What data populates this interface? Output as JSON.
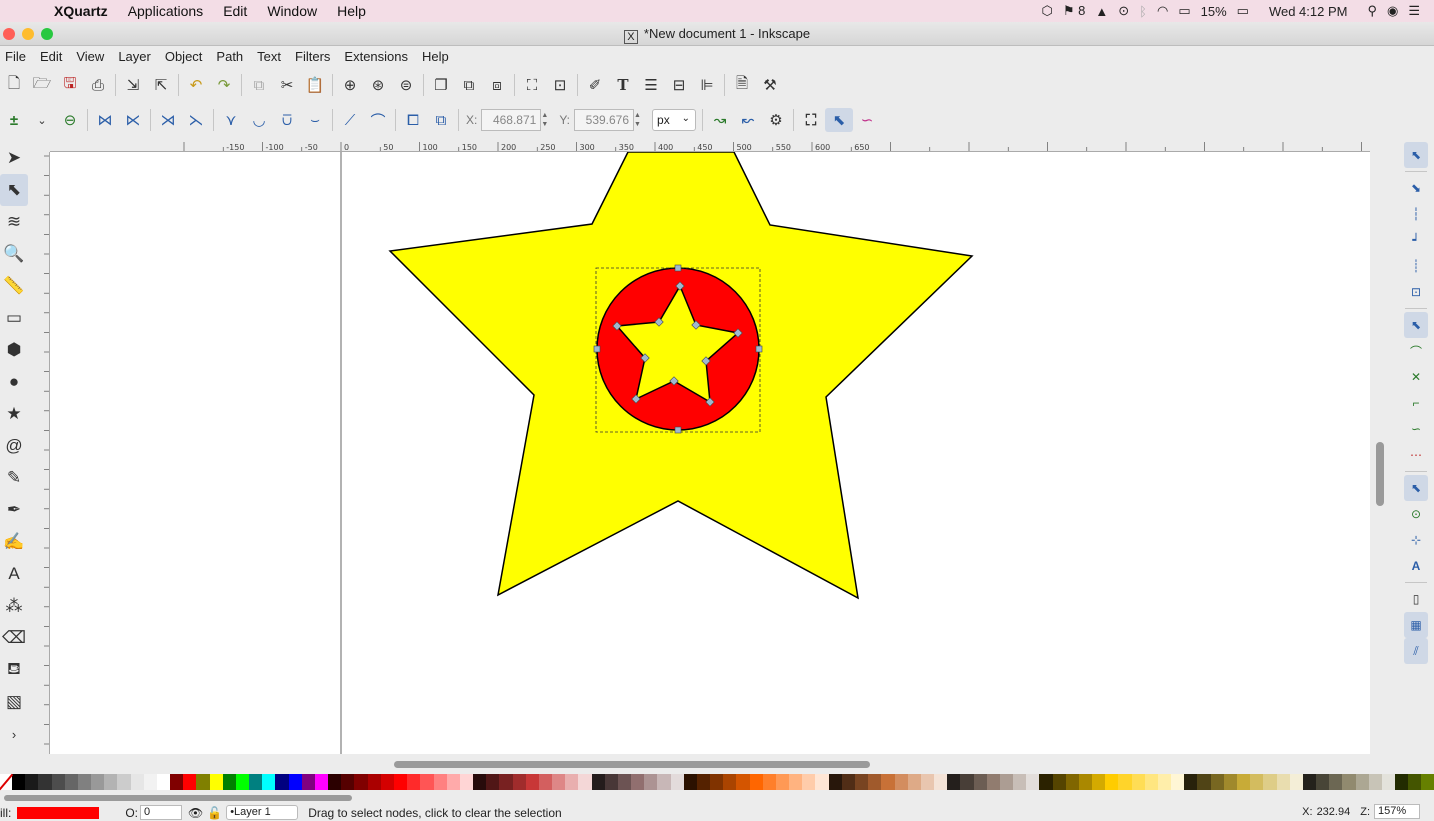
{
  "mac_menubar": {
    "app_name": "XQuartz",
    "menus": [
      "Applications",
      "Edit",
      "Window",
      "Help"
    ],
    "status": {
      "notification_count": "8",
      "battery": "15%",
      "clock": "Wed 4:12 PM"
    }
  },
  "window": {
    "title": "*New document 1 - Inkscape",
    "traffic_lights": [
      "#ff5f57",
      "#febc2e",
      "#28c840"
    ]
  },
  "app_menu": [
    "File",
    "Edit",
    "View",
    "Layer",
    "Object",
    "Path",
    "Text",
    "Filters",
    "Extensions",
    "Help"
  ],
  "command_bar": {
    "groups": [
      [
        "new-document-icon",
        "open-icon",
        "save-icon",
        "print-icon"
      ],
      [
        "import-icon",
        "export-icon"
      ],
      [
        "undo-icon",
        "redo-icon"
      ],
      [
        "copy-icon",
        "cut-icon",
        "paste-icon"
      ],
      [
        "zoom-selection-icon",
        "zoom-drawing-icon",
        "zoom-page-icon"
      ],
      [
        "duplicate-icon",
        "clone-icon",
        "unlink-clone-icon"
      ],
      [
        "group-icon",
        "ungroup-icon"
      ],
      [
        "xml-editor-icon",
        "text-font-icon",
        "layers-icon",
        "fill-stroke-icon",
        "align-distribute-icon"
      ],
      [
        "document-properties-icon",
        "preferences-icon"
      ]
    ]
  },
  "node_toolbar": {
    "x_label": "X:",
    "x_value": "468.871",
    "y_label": "Y:",
    "y_value": "539.676",
    "unit": "px"
  },
  "tools": [
    {
      "name": "selector-tool-icon",
      "glyph": "➤",
      "active": false
    },
    {
      "name": "node-tool-icon",
      "glyph": "⬉",
      "active": true
    },
    {
      "name": "tweak-tool-icon",
      "glyph": "≋",
      "active": false
    },
    {
      "name": "zoom-tool-icon",
      "glyph": "🔍",
      "active": false
    },
    {
      "name": "measure-tool-icon",
      "glyph": "📏",
      "active": false
    },
    {
      "name": "rectangle-tool-icon",
      "glyph": "▭",
      "active": false
    },
    {
      "name": "3d-box-tool-icon",
      "glyph": "⬢",
      "active": false
    },
    {
      "name": "ellipse-tool-icon",
      "glyph": "●",
      "active": false
    },
    {
      "name": "star-tool-icon",
      "glyph": "★",
      "active": false
    },
    {
      "name": "spiral-tool-icon",
      "glyph": "@",
      "active": false
    },
    {
      "name": "pencil-tool-icon",
      "glyph": "✎",
      "active": false
    },
    {
      "name": "pen-tool-icon",
      "glyph": "✒",
      "active": false
    },
    {
      "name": "calligraphy-tool-icon",
      "glyph": "✍",
      "active": false
    },
    {
      "name": "text-tool-icon",
      "glyph": "A",
      "active": false
    },
    {
      "name": "spray-tool-icon",
      "glyph": "⁂",
      "active": false
    },
    {
      "name": "eraser-tool-icon",
      "glyph": "⌫",
      "active": false
    },
    {
      "name": "paint-bucket-tool-icon",
      "glyph": "⛾",
      "active": false
    },
    {
      "name": "gradient-tool-icon",
      "glyph": "▧",
      "active": false
    }
  ],
  "ruler": {
    "top_labels": [
      "-150",
      "-100",
      "-50",
      "0",
      "50",
      "100",
      "150",
      "200",
      "250",
      "300",
      "350",
      "400",
      "450",
      "500",
      "550",
      "600",
      "650"
    ]
  },
  "canvas": {
    "big_star_fill": "#ffff00",
    "circle_fill": "#ff0000",
    "inner_star_fill": "#ffff00",
    "stroke": "#000000",
    "node_color": "#9fb8cf"
  },
  "palette": [
    "#000000",
    "#1a1a1a",
    "#333333",
    "#4d4d4d",
    "#666666",
    "#808080",
    "#999999",
    "#b3b3b3",
    "#cccccc",
    "#e6e6e6",
    "#f2f2f2",
    "#ffffff",
    "#800000",
    "#ff0000",
    "#808000",
    "#ffff00",
    "#008000",
    "#00ff00",
    "#008080",
    "#00ffff",
    "#000080",
    "#0000ff",
    "#800080",
    "#ff00ff",
    "#2b0000",
    "#550000",
    "#800000",
    "#aa0000",
    "#d40000",
    "#ff0000",
    "#ff2a2a",
    "#ff5555",
    "#ff8080",
    "#ffaaaa",
    "#ffd5d5",
    "#280b0b",
    "#501616",
    "#782121",
    "#a02c2c",
    "#c83737",
    "#d35f5f",
    "#de8787",
    "#e9afaf",
    "#f4d7d7",
    "#241c1c",
    "#483737",
    "#6c5353",
    "#916f6f",
    "#ac9393",
    "#c8b7b7",
    "#e3dbdb",
    "#2b1100",
    "#552200",
    "#803300",
    "#aa4400",
    "#d45500",
    "#ff6600",
    "#ff7f2a",
    "#ff9955",
    "#ffb380",
    "#ffccaa",
    "#ffe6d5",
    "#28170b",
    "#502d16",
    "#784421",
    "#a05a2c",
    "#c87137",
    "#d38d5f",
    "#deaa87",
    "#e9c6af",
    "#f4e3d7",
    "#241f1c",
    "#483e37",
    "#6c5d53",
    "#917c6f",
    "#ac9d93",
    "#c8beb7",
    "#e3dedb",
    "#2b2200",
    "#554400",
    "#806600",
    "#aa8800",
    "#d4aa00",
    "#ffcc00",
    "#ffd42a",
    "#ffdd55",
    "#ffe680",
    "#ffeeaa",
    "#fff6d5",
    "#28220b",
    "#504416",
    "#786721",
    "#a0892c",
    "#c8ab37",
    "#d3bc5f",
    "#decd87",
    "#e9ddaf",
    "#f4eed7",
    "#24221c",
    "#484537",
    "#6c6753",
    "#918a6f",
    "#aca793",
    "#c8c4b7",
    "#e3e2db",
    "#222b00",
    "#445500",
    "#668000"
  ],
  "statusbar": {
    "fill_label": "ill:",
    "fill_color": "#ff0000",
    "opacity_label": "O:",
    "opacity_value": "0",
    "layer": "•Layer 1",
    "message": "Drag to select nodes, click to clear the selection",
    "cursor_x_label": "X:",
    "cursor_x": "232.94",
    "zoom_label": "Z:",
    "zoom": "157%"
  }
}
